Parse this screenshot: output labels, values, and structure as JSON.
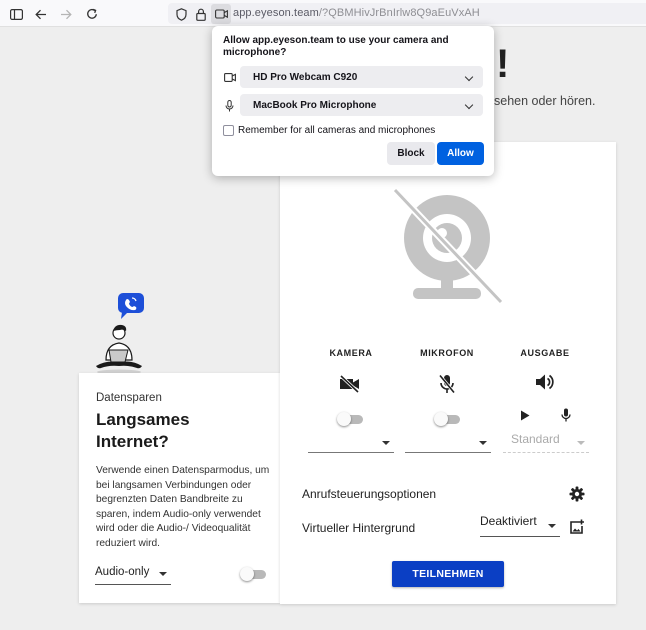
{
  "browser": {
    "url_host": "app.eyeson.team",
    "url_path": "/?QBMHivJrBnIrlw8Q9aEuVxAH",
    "icons": [
      "sidebar-icon",
      "back-icon",
      "forward-icon",
      "reload-icon",
      "shield-icon",
      "lock-icon",
      "camera-permission-icon"
    ]
  },
  "permission_popup": {
    "title": "Allow app.eyeson.team to use your camera and microphone?",
    "camera_device": "HD Pro Webcam C920",
    "microphone_device": "MacBook Pro Microphone",
    "remember_label": "Remember for all cameras and microphones",
    "remember_checked": false,
    "block_label": "Block",
    "allow_label": "Allow",
    "allow_color": "#0061e0"
  },
  "page_background": {
    "heading_fragment": "!",
    "subtitle_fragment": "sehen oder hören."
  },
  "datensparen_card": {
    "kicker": "Datensparen",
    "title": "Langsames Internet?",
    "description": "Verwende einen Datensparmodus, um bei langsamen Verbindungen oder begrenzten Daten Bandbreite zu sparen, indem Audio-only verwendet wird oder die Audio-/ Videoqualität reduziert wird.",
    "mode_select": "Audio-only",
    "toggle_on": false
  },
  "device_card": {
    "columns": [
      {
        "label": "KAMERA",
        "icon": "camera-off-icon",
        "toggle_on": false,
        "select_value": ""
      },
      {
        "label": "MIKROFON",
        "icon": "mic-off-icon",
        "toggle_on": false,
        "select_value": ""
      },
      {
        "label": "AUSGABE",
        "icon": "speaker-icon",
        "select_value": "Standard"
      }
    ],
    "call_options_label": "Anrufsteuerungsoptionen",
    "virtual_bg_label": "Virtueller Hintergrund",
    "virtual_bg_value": "Deaktiviert",
    "join_label": "TEILNEHMEN",
    "join_color": "#0b3fc4"
  }
}
